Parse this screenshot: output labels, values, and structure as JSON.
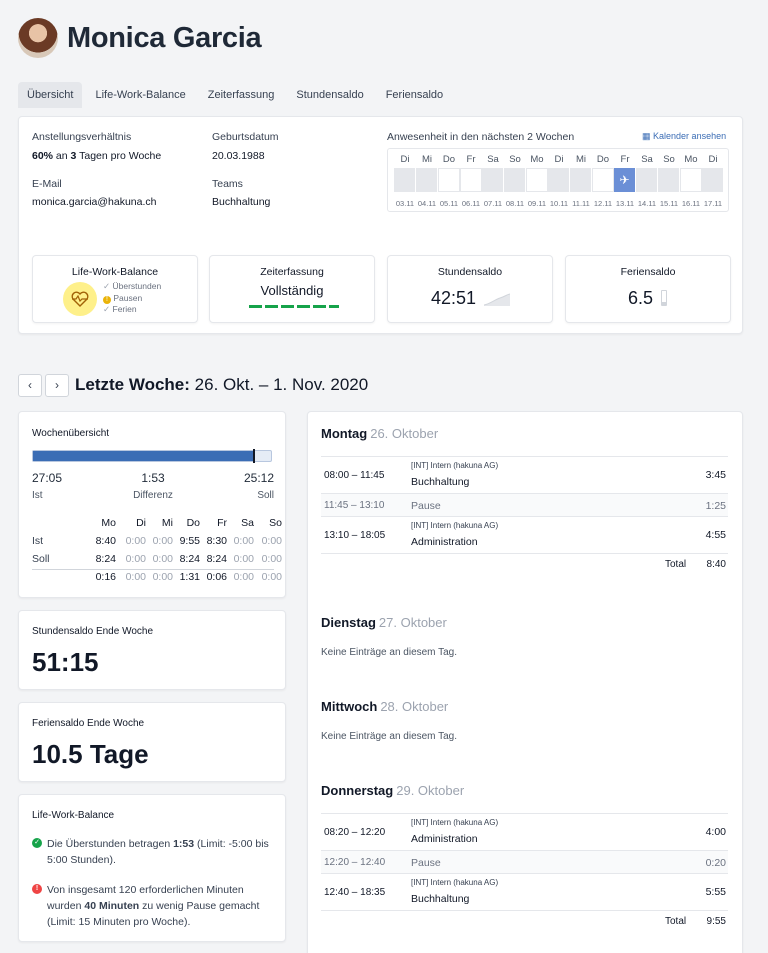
{
  "header": {
    "name": "Monica Garcia"
  },
  "tabs": [
    "Übersicht",
    "Life-Work-Balance",
    "Zeiterfassung",
    "Stundensaldo",
    "Feriensaldo"
  ],
  "profile": {
    "employment_label": "Anstellungsverhältnis",
    "employment_pct": "60%",
    "employment_mid": " an ",
    "employment_days": "3",
    "employment_rest": " Tagen pro Woche",
    "birth_label": "Geburtsdatum",
    "birth_value": "20.03.1988",
    "email_label": "E-Mail",
    "email_value": "monica.garcia@hakuna.ch",
    "teams_label": "Teams",
    "teams_value": "Buchhaltung"
  },
  "calendar": {
    "title": "Anwesenheit in den nächsten 2 Wochen",
    "link": "Kalender ansehen",
    "days": [
      "Di",
      "Mi",
      "Do",
      "Fr",
      "Sa",
      "So",
      "Mo",
      "Di",
      "Mi",
      "Do",
      "Fr",
      "Sa",
      "So",
      "Mo",
      "Di"
    ],
    "dates": [
      "03.11",
      "04.11",
      "05.11",
      "06.11",
      "07.11",
      "08.11",
      "09.11",
      "10.11",
      "11.11",
      "12.11",
      "13.11",
      "14.11",
      "15.11",
      "16.11",
      "17.11"
    ],
    "status": [
      "off",
      "off",
      "on",
      "on",
      "off",
      "off",
      "on",
      "off",
      "off",
      "on",
      "vacation",
      "off",
      "off",
      "on",
      "off"
    ]
  },
  "stats": {
    "lwb_title": "Life-Work-Balance",
    "lwb_items": [
      "Überstunden",
      "Pausen",
      "Ferien"
    ],
    "zeit_title": "Zeiterfassung",
    "zeit_value": "Vollständig",
    "stunden_title": "Stundensaldo",
    "stunden_value": "42:51",
    "ferien_title": "Feriensaldo",
    "ferien_value": "6.5"
  },
  "week": {
    "heading_bold": "Letzte Woche:",
    "heading_range": "26. Okt. – 1. Nov. 2020"
  },
  "overview": {
    "title": "Wochenübersicht",
    "progress": 0.93,
    "ist_value": "27:05",
    "ist_label": "Ist",
    "diff_value": "1:53",
    "diff_label": "Differenz",
    "soll_value": "25:12",
    "soll_label": "Soll",
    "days": [
      "Mo",
      "Di",
      "Mi",
      "Do",
      "Fr",
      "Sa",
      "So"
    ],
    "rows": [
      {
        "label": "Ist",
        "values": [
          "8:40",
          "0:00",
          "0:00",
          "9:55",
          "8:30",
          "0:00",
          "0:00"
        ]
      },
      {
        "label": "Soll",
        "values": [
          "8:24",
          "0:00",
          "0:00",
          "8:24",
          "8:24",
          "0:00",
          "0:00"
        ]
      },
      {
        "label": "",
        "values": [
          "0:16",
          "0:00",
          "0:00",
          "1:31",
          "0:06",
          "0:00",
          "0:00"
        ]
      }
    ]
  },
  "saldo": {
    "title": "Stundensaldo Ende Woche",
    "value": "51:15"
  },
  "ferien": {
    "title": "Feriensaldo Ende Woche",
    "value": "10.5 Tage"
  },
  "lwb": {
    "title": "Life-Work-Balance",
    "msg1_a": "Die Überstunden betragen ",
    "msg1_b": "1:53",
    "msg1_c": " (Limit: -5:00 bis 5:00 Stunden).",
    "msg2_a": "Von insgesamt 120 erforderlichen Minuten wurden ",
    "msg2_b": "40 Minuten",
    "msg2_c": " zu wenig Pause gemacht (Limit: 15 Minuten pro Woche)."
  },
  "days": {
    "montag": {
      "name": "Montag",
      "date": "26. Oktober",
      "entries": [
        {
          "time": "08:00 – 11:45",
          "project": "[INT] Intern (hakuna AG)",
          "task": "Buchhaltung",
          "dur": "3:45"
        },
        {
          "time": "11:45 – 13:10",
          "task": "Pause",
          "dur": "1:25"
        },
        {
          "time": "13:10 – 18:05",
          "project": "[INT] Intern (hakuna AG)",
          "task": "Administration",
          "dur": "4:55"
        }
      ],
      "total_label": "Total",
      "total": "8:40"
    },
    "dienstag": {
      "name": "Dienstag",
      "date": "27. Oktober",
      "none": "Keine Einträge an diesem Tag."
    },
    "mittwoch": {
      "name": "Mittwoch",
      "date": "28. Oktober",
      "none": "Keine Einträge an diesem Tag."
    },
    "donnerstag": {
      "name": "Donnerstag",
      "date": "29. Oktober",
      "entries": [
        {
          "time": "08:20 – 12:20",
          "project": "[INT] Intern (hakuna AG)",
          "task": "Administration",
          "dur": "4:00"
        },
        {
          "time": "12:20 – 12:40",
          "task": "Pause",
          "dur": "0:20"
        },
        {
          "time": "12:40 – 18:35",
          "project": "[INT] Intern (hakuna AG)",
          "task": "Buchhaltung",
          "dur": "5:55"
        }
      ],
      "total_label": "Total",
      "total": "9:55"
    }
  },
  "colors": {
    "accent": "#3b6db5",
    "success": "#16a34a",
    "warning": "#eab308",
    "highlight": "#fef08a"
  }
}
